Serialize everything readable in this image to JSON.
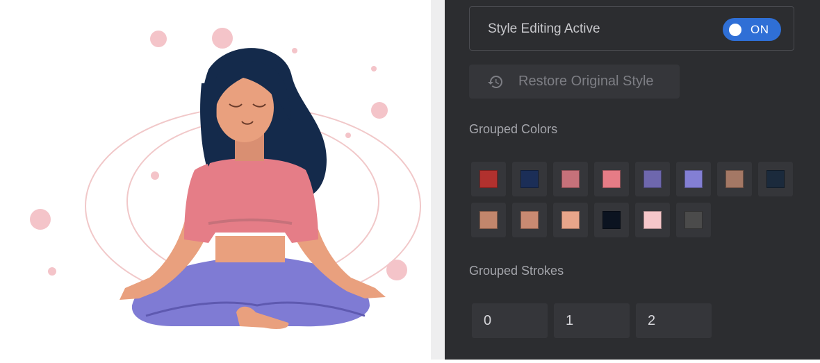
{
  "editor": {
    "style_editing_label": "Style Editing Active",
    "style_editing_state": "ON",
    "restore_label": "Restore Original Style",
    "grouped_colors_title": "Grouped Colors",
    "grouped_strokes_title": "Grouped Strokes",
    "colors": [
      "#b1312e",
      "#1b2e57",
      "#c6717a",
      "#e67c86",
      "#6e67ad",
      "#837fd4",
      "#a47865",
      "#1b2a3c",
      "#c2866c",
      "#c98a72",
      "#e8a58a",
      "#0b1320",
      "#f6c7ca",
      "#4b4b4b"
    ],
    "strokes": [
      "0",
      "1",
      "2"
    ]
  },
  "illustration": {
    "subject": "meditating-woman",
    "palette": {
      "hair": "#142a4b",
      "skin": "#e9a07e",
      "shirt": "#e57d87",
      "pants": "#7f7bd4",
      "dots": "#f4c4c9",
      "rings": "#f1c8c9"
    }
  }
}
